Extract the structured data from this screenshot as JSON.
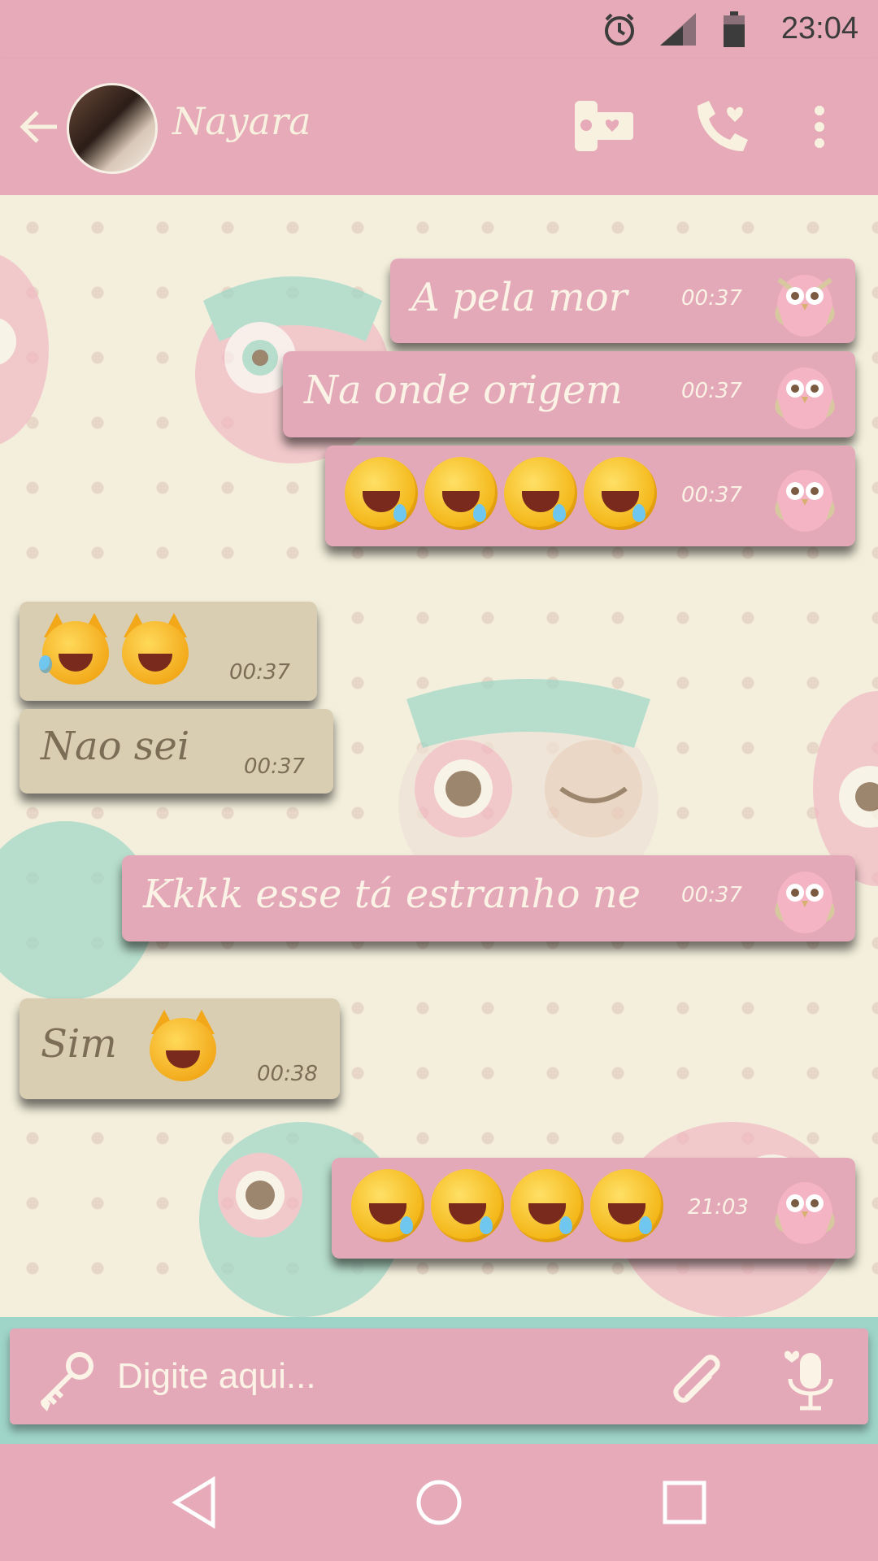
{
  "status_bar": {
    "time": "23:04"
  },
  "header": {
    "contact_name": "Nayara"
  },
  "messages": [
    {
      "direction": "out",
      "text": "A pela mor",
      "time": "00:37"
    },
    {
      "direction": "out",
      "text": "Na onde origem",
      "time": "00:37"
    },
    {
      "direction": "out",
      "emoji": "rolling-on-floor-laughing x4",
      "time": "00:37"
    },
    {
      "direction": "in",
      "emoji": "cat-tears-of-joy x2",
      "time": "00:37"
    },
    {
      "direction": "in",
      "text": "Nao sei",
      "time": "00:37"
    },
    {
      "direction": "out",
      "text": "Kkkk esse tá estranho ne",
      "time": "00:37"
    },
    {
      "direction": "in",
      "text": "Sim",
      "emoji": "cat-tears-of-joy",
      "time": "00:38"
    },
    {
      "direction": "out",
      "emoji": "rolling-on-floor-laughing x4",
      "time": "21:03"
    }
  ],
  "composer": {
    "placeholder": "Digite aqui..."
  },
  "colors": {
    "bar": "#e6aab8",
    "outgoing_bubble": "#e4a9b8",
    "incoming_bubble": "#d9cdb2",
    "chat_background": "#f3efdc",
    "input_strip": "#9fd4c8"
  }
}
